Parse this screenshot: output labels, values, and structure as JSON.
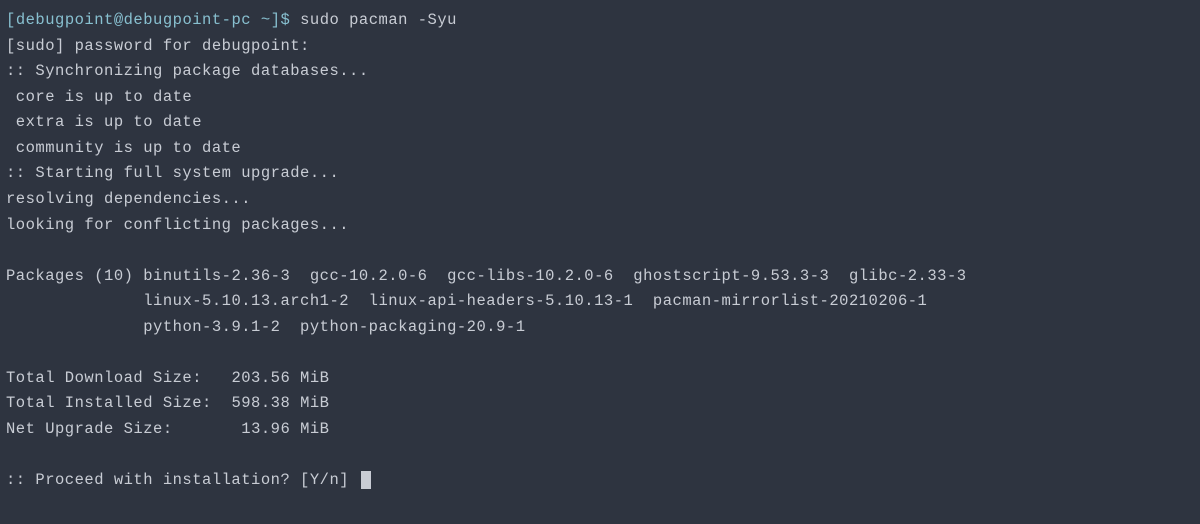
{
  "prompt": {
    "user_host": "debugpoint@debugpoint-pc",
    "cwd": "~",
    "symbol": "$",
    "command": "sudo pacman -Syu"
  },
  "lines": {
    "sudo_password": "[sudo] password for debugpoint:",
    "sync_db": ":: Synchronizing package databases...",
    "core": " core is up to date",
    "extra": " extra is up to date",
    "community": " community is up to date",
    "upgrade": ":: Starting full system upgrade...",
    "resolving": "resolving dependencies...",
    "conflicting": "looking for conflicting packages..."
  },
  "packages": {
    "header": "Packages (10)",
    "line1": "binutils-2.36-3  gcc-10.2.0-6  gcc-libs-10.2.0-6  ghostscript-9.53.3-3  glibc-2.33-3",
    "line2": "linux-5.10.13.arch1-2  linux-api-headers-5.10.13-1  pacman-mirrorlist-20210206-1",
    "line3": "python-3.9.1-2  python-packaging-20.9-1"
  },
  "sizes": {
    "download_label": "Total Download Size:",
    "download_value": "203.56 MiB",
    "installed_label": "Total Installed Size:",
    "installed_value": "598.38 MiB",
    "upgrade_label": "Net Upgrade Size:",
    "upgrade_value": "13.96 MiB"
  },
  "proceed": ":: Proceed with installation? [Y/n] "
}
